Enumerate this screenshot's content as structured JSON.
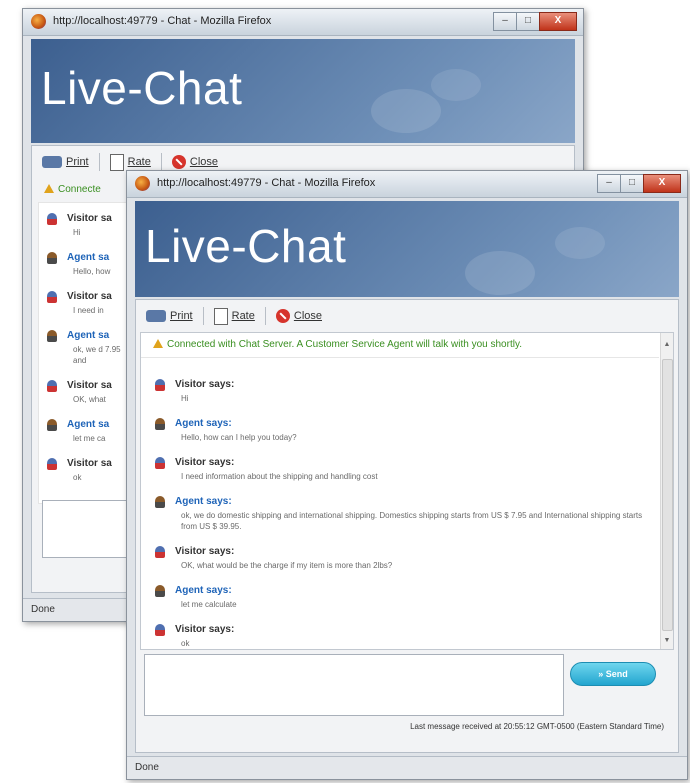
{
  "browser": {
    "title": "http://localhost:49779 - Chat - Mozilla Firefox",
    "controls": {
      "minimize": "–",
      "maximize": "□",
      "close": "X"
    },
    "status_text": "Done"
  },
  "brand": "Live-Chat",
  "toolbar": {
    "print_label": "Print",
    "rate_label": "Rate",
    "close_label": "Close"
  },
  "connection": {
    "full": "Connected with Chat Server. A Customer Service Agent will talk with you shortly.",
    "truncated": "Connecte"
  },
  "messages": [
    {
      "role": "visitor",
      "label": "Visitor says:",
      "text": "Hi"
    },
    {
      "role": "agent",
      "label": "Agent says:",
      "text": "Hello, how can I help you today?"
    },
    {
      "role": "visitor",
      "label": "Visitor says:",
      "text": "I need information about the shipping and handling cost"
    },
    {
      "role": "agent",
      "label": "Agent says:",
      "text": "ok, we do domestic shipping and international shipping. Domestics shipping starts from US $ 7.95 and International shipping starts from US $ 39.95."
    },
    {
      "role": "visitor",
      "label": "Visitor says:",
      "text": "OK, what would be the charge if my item is more than 2lbs?"
    },
    {
      "role": "agent",
      "label": "Agent says:",
      "text": "let me calculate"
    },
    {
      "role": "visitor",
      "label": "Visitor says:",
      "text": "ok"
    }
  ],
  "back_window": {
    "messages": [
      {
        "role": "visitor",
        "label": "Visitor sa",
        "text": "Hi"
      },
      {
        "role": "agent",
        "label": "Agent sa",
        "text": "Hello, how"
      },
      {
        "role": "visitor",
        "label": "Visitor sa",
        "text": "I need in"
      },
      {
        "role": "agent",
        "label": "Agent sa",
        "text": "ok, we d  7.95 and"
      },
      {
        "role": "visitor",
        "label": "Visitor sa",
        "text": "OK, what"
      },
      {
        "role": "agent",
        "label": "Agent sa",
        "text": "let me ca"
      },
      {
        "role": "visitor",
        "label": "Visitor sa",
        "text": "ok"
      }
    ]
  },
  "composer": {
    "send_label": "» Send",
    "last_message": "Last message received at 20:55:12 GMT-0500 (Eastern Standard Time)"
  },
  "colors": {
    "header": "#4a6fa0",
    "status_green": "#3a8f21",
    "agent_blue": "#1f64b8",
    "send_cyan": "#2fb6dc",
    "close_red": "#c0331a"
  }
}
